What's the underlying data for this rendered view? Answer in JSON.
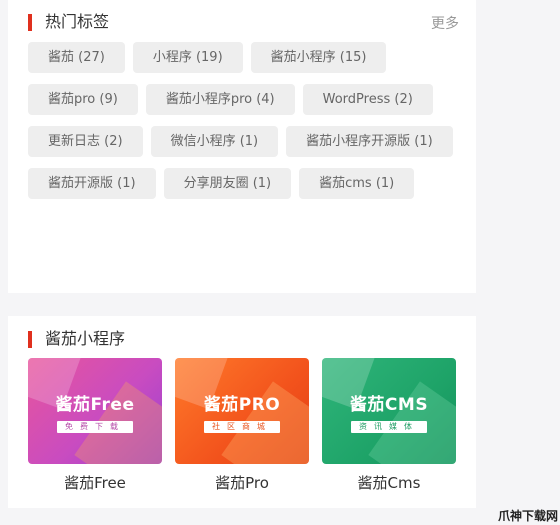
{
  "hot_tags": {
    "title": "热门标签",
    "more_label": "更多",
    "tags": [
      "酱茄 (27)",
      "小程序 (19)",
      "酱茄小程序 (15)",
      "酱茄pro (9)",
      "酱茄小程序pro (4)",
      "WordPress (2)",
      "更新日志 (2)",
      "微信小程序 (1)",
      "酱茄小程序开源版 (1)",
      "酱茄开源版 (1)",
      "分享朋友圈 (1)",
      "酱茄cms (1)"
    ]
  },
  "mini_apps": {
    "title": "酱茄小程序",
    "apps": [
      {
        "name": "酱茄Free",
        "banner_title": "酱茄Free",
        "banner_subtitle": "免费下载",
        "accent": "#c94cc0"
      },
      {
        "name": "酱茄Pro",
        "banner_title": "酱茄PRO",
        "banner_subtitle": "社区商城",
        "accent": "#f2521c"
      },
      {
        "name": "酱茄Cms",
        "banner_title": "酱茄CMS",
        "banner_subtitle": "资讯媒体",
        "accent": "#1ea368"
      }
    ]
  },
  "watermark": "爪神下载网",
  "colors": {
    "title_bar": "#e0301e",
    "tag_background": "#eeeeee",
    "page_background": "#f5f5f7"
  }
}
